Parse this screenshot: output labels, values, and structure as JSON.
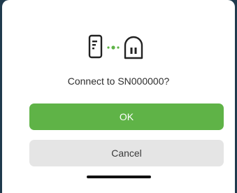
{
  "dialog": {
    "message": "Connect to SN000000?",
    "ok_label": "OK",
    "cancel_label": "Cancel"
  },
  "icons": {
    "phone": "phone-icon",
    "connection": "connection-dots-icon",
    "device": "device-pause-icon"
  },
  "colors": {
    "accent": "#5fb347",
    "cancel_bg": "#e5e5e5",
    "backdrop": "#1f3a4d"
  }
}
